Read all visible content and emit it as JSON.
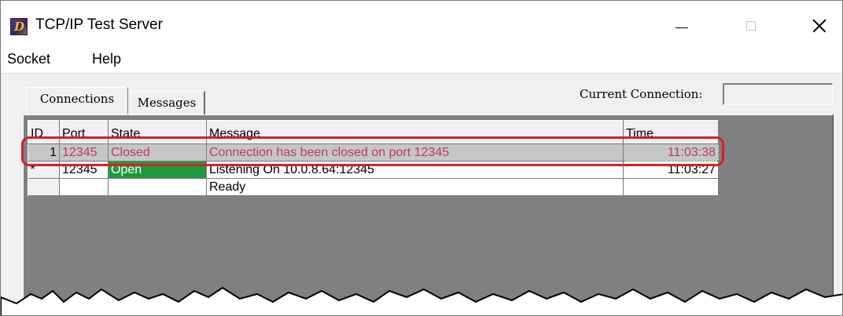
{
  "window": {
    "title": "TCP/IP Test Server",
    "app_icon_letter": "D"
  },
  "menu": {
    "items": [
      "Socket",
      "Help"
    ]
  },
  "tabs": [
    "Connections",
    "Messages"
  ],
  "current_connection": {
    "label": "Current Connection:",
    "value": ""
  },
  "grid": {
    "columns": [
      "ID",
      "Port",
      "State",
      "Message",
      "Time"
    ],
    "rows": [
      {
        "id": "1",
        "port": "12345",
        "state": "Closed",
        "message": "Connection has been closed on port 12345",
        "time": "11:03:38"
      },
      {
        "id": "*",
        "port": "12345",
        "state": "Open",
        "message": "Listening On 10.0.8.64:12345",
        "time": "11:03:27"
      },
      {
        "id": "",
        "port": "",
        "state": "",
        "message": "Ready",
        "time": ""
      }
    ]
  },
  "colors": {
    "highlight_border": "#d81e2a",
    "closed_text": "#b73a6a",
    "open_state_bg": "#1f9a3a",
    "panel_bg": "#808080"
  }
}
